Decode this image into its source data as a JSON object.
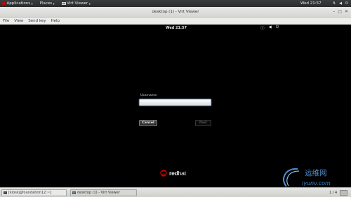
{
  "host_topbar": {
    "applications_label": "Applications",
    "places_label": "Places",
    "window_label": "Virt Viewer",
    "clock": "Wed 21:57"
  },
  "window": {
    "title": "desktop (1) - Virt Viewer"
  },
  "menubar": {
    "items": [
      "File",
      "View",
      "Send key",
      "Help"
    ]
  },
  "guest": {
    "clock": "Wed 21:57",
    "username_label": "Username:",
    "username_value": "",
    "cancel_label": "Cancel",
    "next_label": "Next",
    "logo_red": "red",
    "logo_hat": "hat"
  },
  "taskbar": {
    "tasks": [
      {
        "label": "[kiosk@foundation12:~]"
      },
      {
        "label": "desktop (1) - Virt Viewer"
      }
    ],
    "pager": "1 / 4"
  },
  "watermark": {
    "cn": "运维网",
    "url": "iyunv.com"
  },
  "colors": {
    "redhat_red": "#cc0000",
    "focus_blue": "#8aa9d4",
    "watermark_blue": "#4f8fd6"
  }
}
